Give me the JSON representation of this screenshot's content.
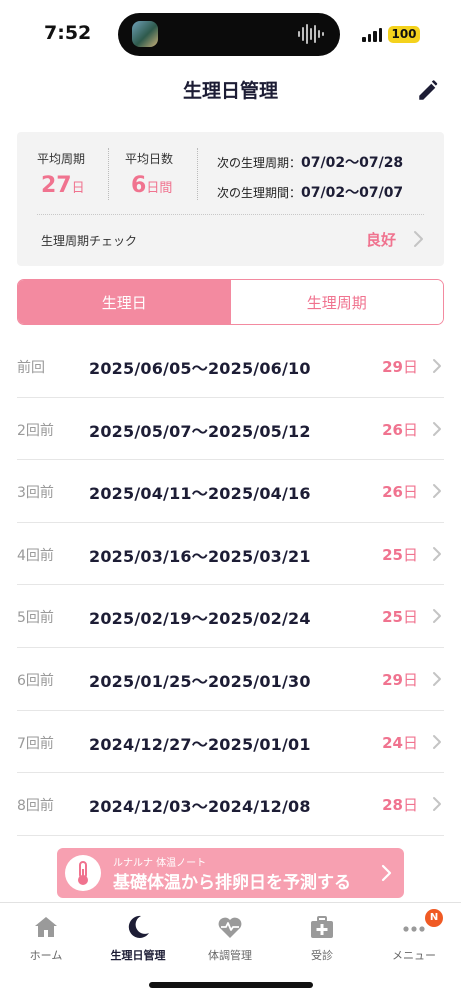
{
  "status_bar": {
    "time": "7:52",
    "battery": "100",
    "icons": [
      "island-media-thumbnail",
      "audio-wave-icon",
      "signal-icon",
      "battery-icon"
    ]
  },
  "header": {
    "title": "生理日管理",
    "edit_icon": "pencil-icon"
  },
  "summary": {
    "avg_cycle": {
      "label": "平均周期",
      "value": "27",
      "unit": "日"
    },
    "avg_days": {
      "label": "平均日数",
      "value": "6",
      "unit": "日間"
    },
    "next_cycle": {
      "label": "次の生理周期：",
      "value": "07/02〜07/28"
    },
    "next_period": {
      "label": "次の生理期間：",
      "value": "07/02〜07/07"
    },
    "check": {
      "label": "生理周期チェック",
      "result": "良好"
    }
  },
  "tabs": [
    {
      "label": "生理日",
      "active": true
    },
    {
      "label": "生理周期",
      "active": false
    }
  ],
  "history": [
    {
      "ago": "前回",
      "range": "2025/06/05〜2025/06/10",
      "length": "29",
      "unit": "日"
    },
    {
      "ago": "2回前",
      "range": "2025/05/07〜2025/05/12",
      "length": "26",
      "unit": "日"
    },
    {
      "ago": "3回前",
      "range": "2025/04/11〜2025/04/16",
      "length": "26",
      "unit": "日"
    },
    {
      "ago": "4回前",
      "range": "2025/03/16〜2025/03/21",
      "length": "25",
      "unit": "日"
    },
    {
      "ago": "5回前",
      "range": "2025/02/19〜2025/02/24",
      "length": "25",
      "unit": "日"
    },
    {
      "ago": "6回前",
      "range": "2025/01/25〜2025/01/30",
      "length": "29",
      "unit": "日"
    },
    {
      "ago": "7回前",
      "range": "2024/12/27〜2025/01/01",
      "length": "24",
      "unit": "日"
    },
    {
      "ago": "8回前",
      "range": "2024/12/03〜2024/12/08",
      "length": "28",
      "unit": "日"
    }
  ],
  "banner": {
    "subtitle": "ルナルナ 体温ノート",
    "title": "基礎体温から排卵日を予測する",
    "icon": "thermometer-icon"
  },
  "nav": [
    {
      "label": "ホーム",
      "icon": "home-icon",
      "active": false
    },
    {
      "label": "生理日管理",
      "icon": "moon-icon",
      "active": true
    },
    {
      "label": "体調管理",
      "icon": "heart-pulse-icon",
      "active": false
    },
    {
      "label": "受診",
      "icon": "medical-bag-icon",
      "active": false
    },
    {
      "label": "メニュー",
      "icon": "more-icon",
      "active": false,
      "badge": "N"
    }
  ],
  "colors": {
    "accent_pink": "#f0738f",
    "tab_pink": "#f38aa0",
    "banner_pink": "#f7a0b1",
    "navy": "#1d1d35",
    "card_bg": "#f3f3f3",
    "badge_orange": "#f05a24"
  }
}
